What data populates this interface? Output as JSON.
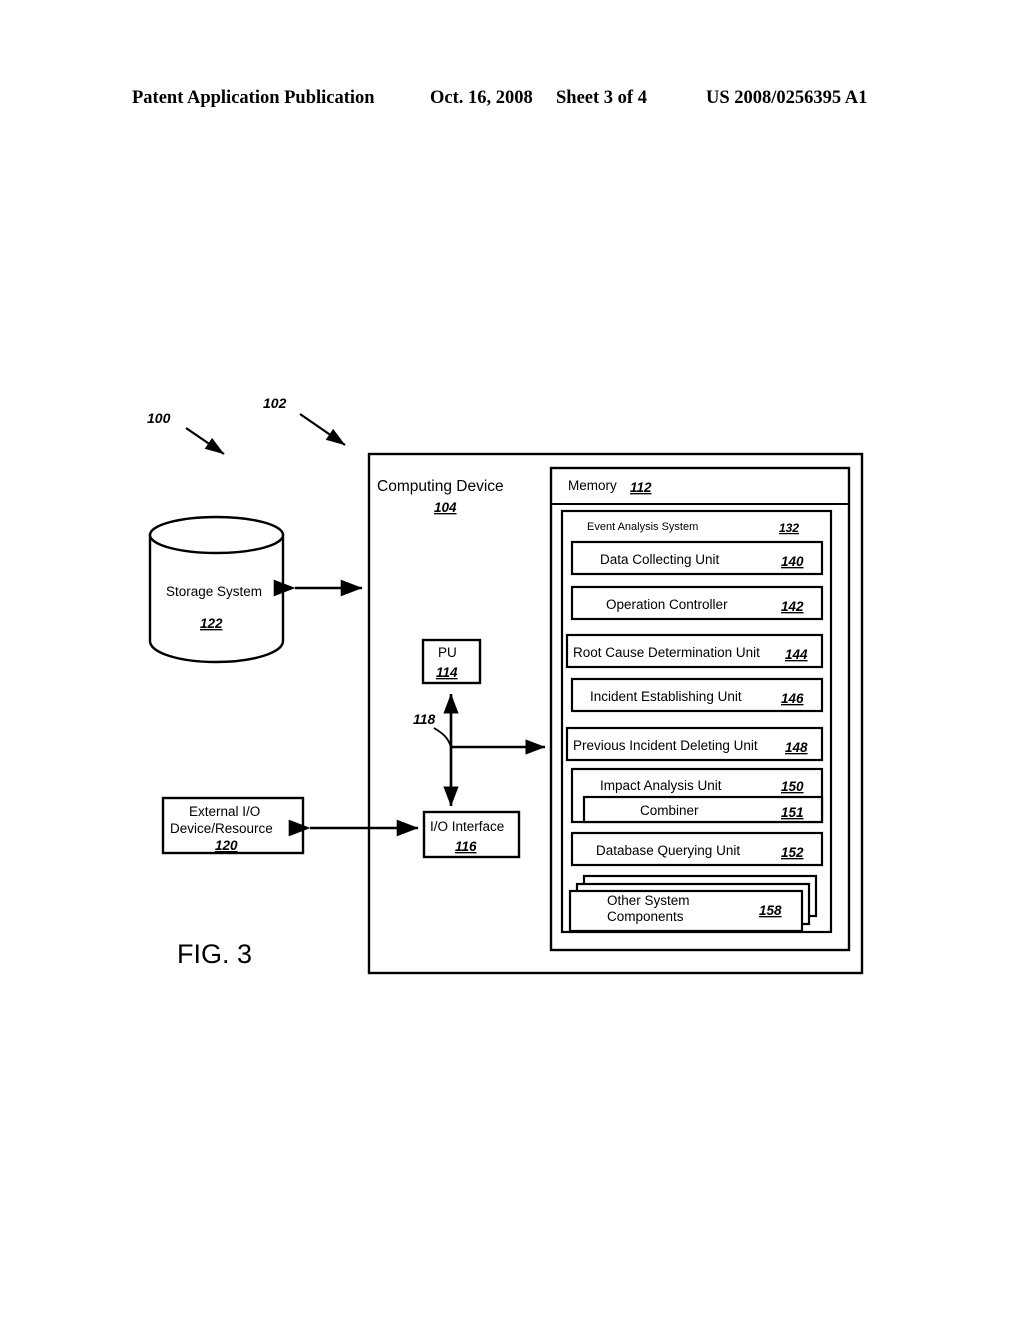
{
  "header": {
    "publication": "Patent Application Publication",
    "date": "Oct. 16, 2008",
    "sheet": "Sheet 3 of 4",
    "patent_number": "US 2008/0256395 A1"
  },
  "figure": {
    "label": "FIG. 3",
    "callouts": [
      {
        "id": "100",
        "text": "100"
      },
      {
        "id": "102",
        "text": "102"
      },
      {
        "id": "118",
        "text": "118"
      }
    ],
    "storage_system": {
      "label": "Storage System",
      "ref": "122"
    },
    "external_io": {
      "line1": "External I/O",
      "line2": "Device/Resource",
      "ref": "120"
    },
    "io_interface": {
      "label": "I/O Interface",
      "ref": "116"
    },
    "pu": {
      "label": "PU",
      "ref": "114"
    },
    "computing_device": {
      "label": "Computing Device",
      "ref": "104"
    },
    "memory": {
      "label": "Memory",
      "ref": "112"
    },
    "event_analysis_system": {
      "label": "Event Analysis System",
      "ref": "132"
    },
    "units": [
      {
        "label": "Data Collecting Unit",
        "ref": "140"
      },
      {
        "label": "Operation Controller",
        "ref": "142"
      },
      {
        "label": "Root Cause Determination Unit",
        "ref": "144"
      },
      {
        "label": "Incident Establishing Unit",
        "ref": "146"
      },
      {
        "label": "Previous Incident Deleting Unit",
        "ref": "148"
      },
      {
        "label": "Impact Analysis Unit",
        "ref": "150"
      },
      {
        "label": "Database Querying Unit",
        "ref": "152"
      }
    ],
    "combiner": {
      "label": "Combiner",
      "ref": "151"
    },
    "other_components": {
      "line1": "Other System",
      "line2": "Components",
      "ref": "158"
    }
  }
}
